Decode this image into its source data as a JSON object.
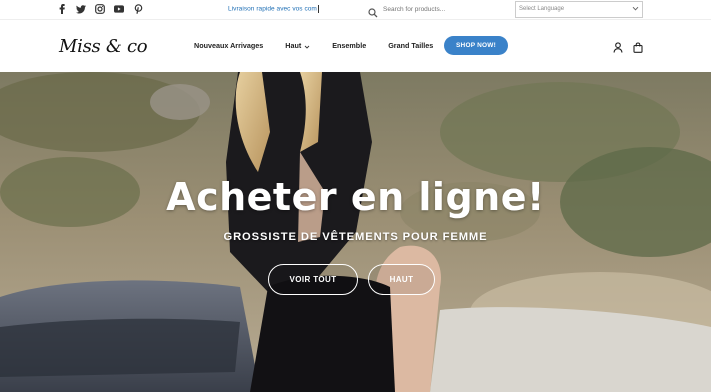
{
  "topbar": {
    "social_icons": [
      "facebook-icon",
      "twitter-icon",
      "instagram-icon",
      "youtube-icon",
      "pinterest-icon"
    ],
    "ticker_text": "Livraison rapide avec vos com",
    "search": {
      "placeholder": "Search for products..."
    },
    "language": {
      "value": "Select Language"
    }
  },
  "header": {
    "logo": "Miss & co",
    "nav": [
      "Nouveaux Arrivages",
      "Haut",
      "Ensemble",
      "Grand Tailles"
    ],
    "shop_button": "SHOP NOW!",
    "icons": [
      "account-icon",
      "cart-icon"
    ]
  },
  "hero": {
    "title": "Acheter en ligne!",
    "subtitle": "GROSSISTE DE VÊTEMENTS POUR FEMME",
    "buttons": [
      "VOIR TOUT",
      "HAUT"
    ]
  },
  "colors": {
    "accent": "#3a82c9",
    "ticker": "#1f6fb5"
  }
}
